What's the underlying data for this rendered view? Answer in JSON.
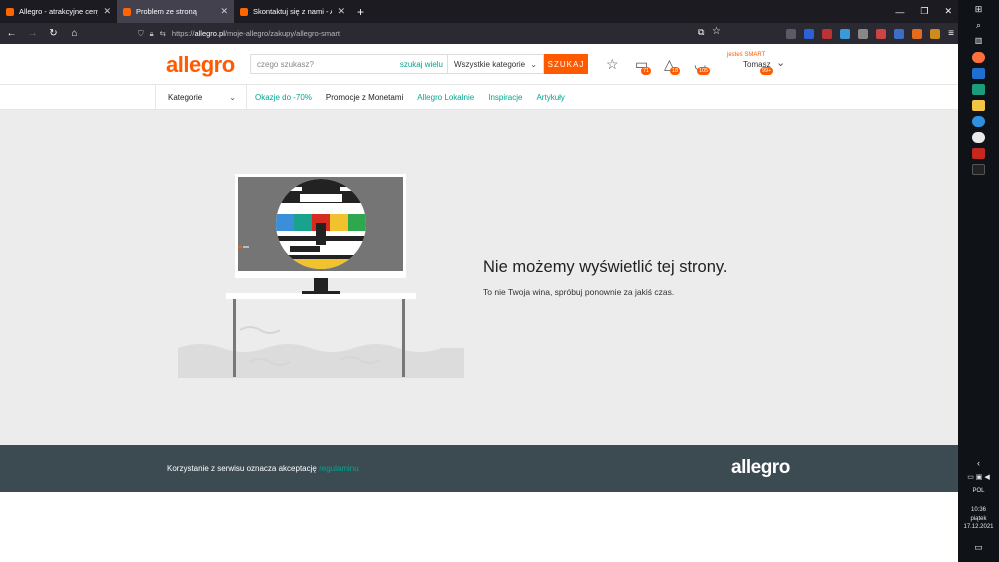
{
  "browser": {
    "tabs": [
      {
        "title": "Allegro - atrakcyjne ceny",
        "active": false
      },
      {
        "title": "Problem ze stroną",
        "active": true
      },
      {
        "title": "Skontaktuj się z nami - Allegro",
        "active": false
      }
    ],
    "new_tab_label": "+",
    "url_protocol": "https://",
    "url_host": "allegro.pl",
    "url_path": "/moje-allegro/zakupy/allegro-smart"
  },
  "header": {
    "logo": "allegro",
    "search_placeholder": "czego szukasz?",
    "search_many": "szukaj wielu",
    "category_select": "Wszystkie kategorie",
    "search_button": "SZUKAJ",
    "messages_badge": "71",
    "notifications_badge": "18",
    "cart_badge": "105",
    "user_smart": "jesteś SMART",
    "user_name": "Tomasz",
    "user_badge": "99+"
  },
  "catbar": {
    "categories_label": "Kategorie",
    "links": [
      "Okazje do -70%",
      "Promocje z Monetami",
      "Allegro Lokalnie",
      "Inspiracje",
      "Artykuły"
    ]
  },
  "error": {
    "title": "Nie możemy wyświetlić tej strony.",
    "subtitle": "To nie Twoja wina, spróbuj ponownie za jakiś czas."
  },
  "footer": {
    "text": "Korzystanie z serwisu oznacza akceptację",
    "link": "regulaminu",
    "logo": "allegro"
  },
  "taskbar": {
    "language": "POL",
    "time": "10:36",
    "day": "piątek",
    "date": "17.12.2021"
  },
  "colors": {
    "accent": "#ff5a00",
    "link": "#00a790",
    "footer_bg": "#3c4a52",
    "page_bg": "#ececec"
  }
}
